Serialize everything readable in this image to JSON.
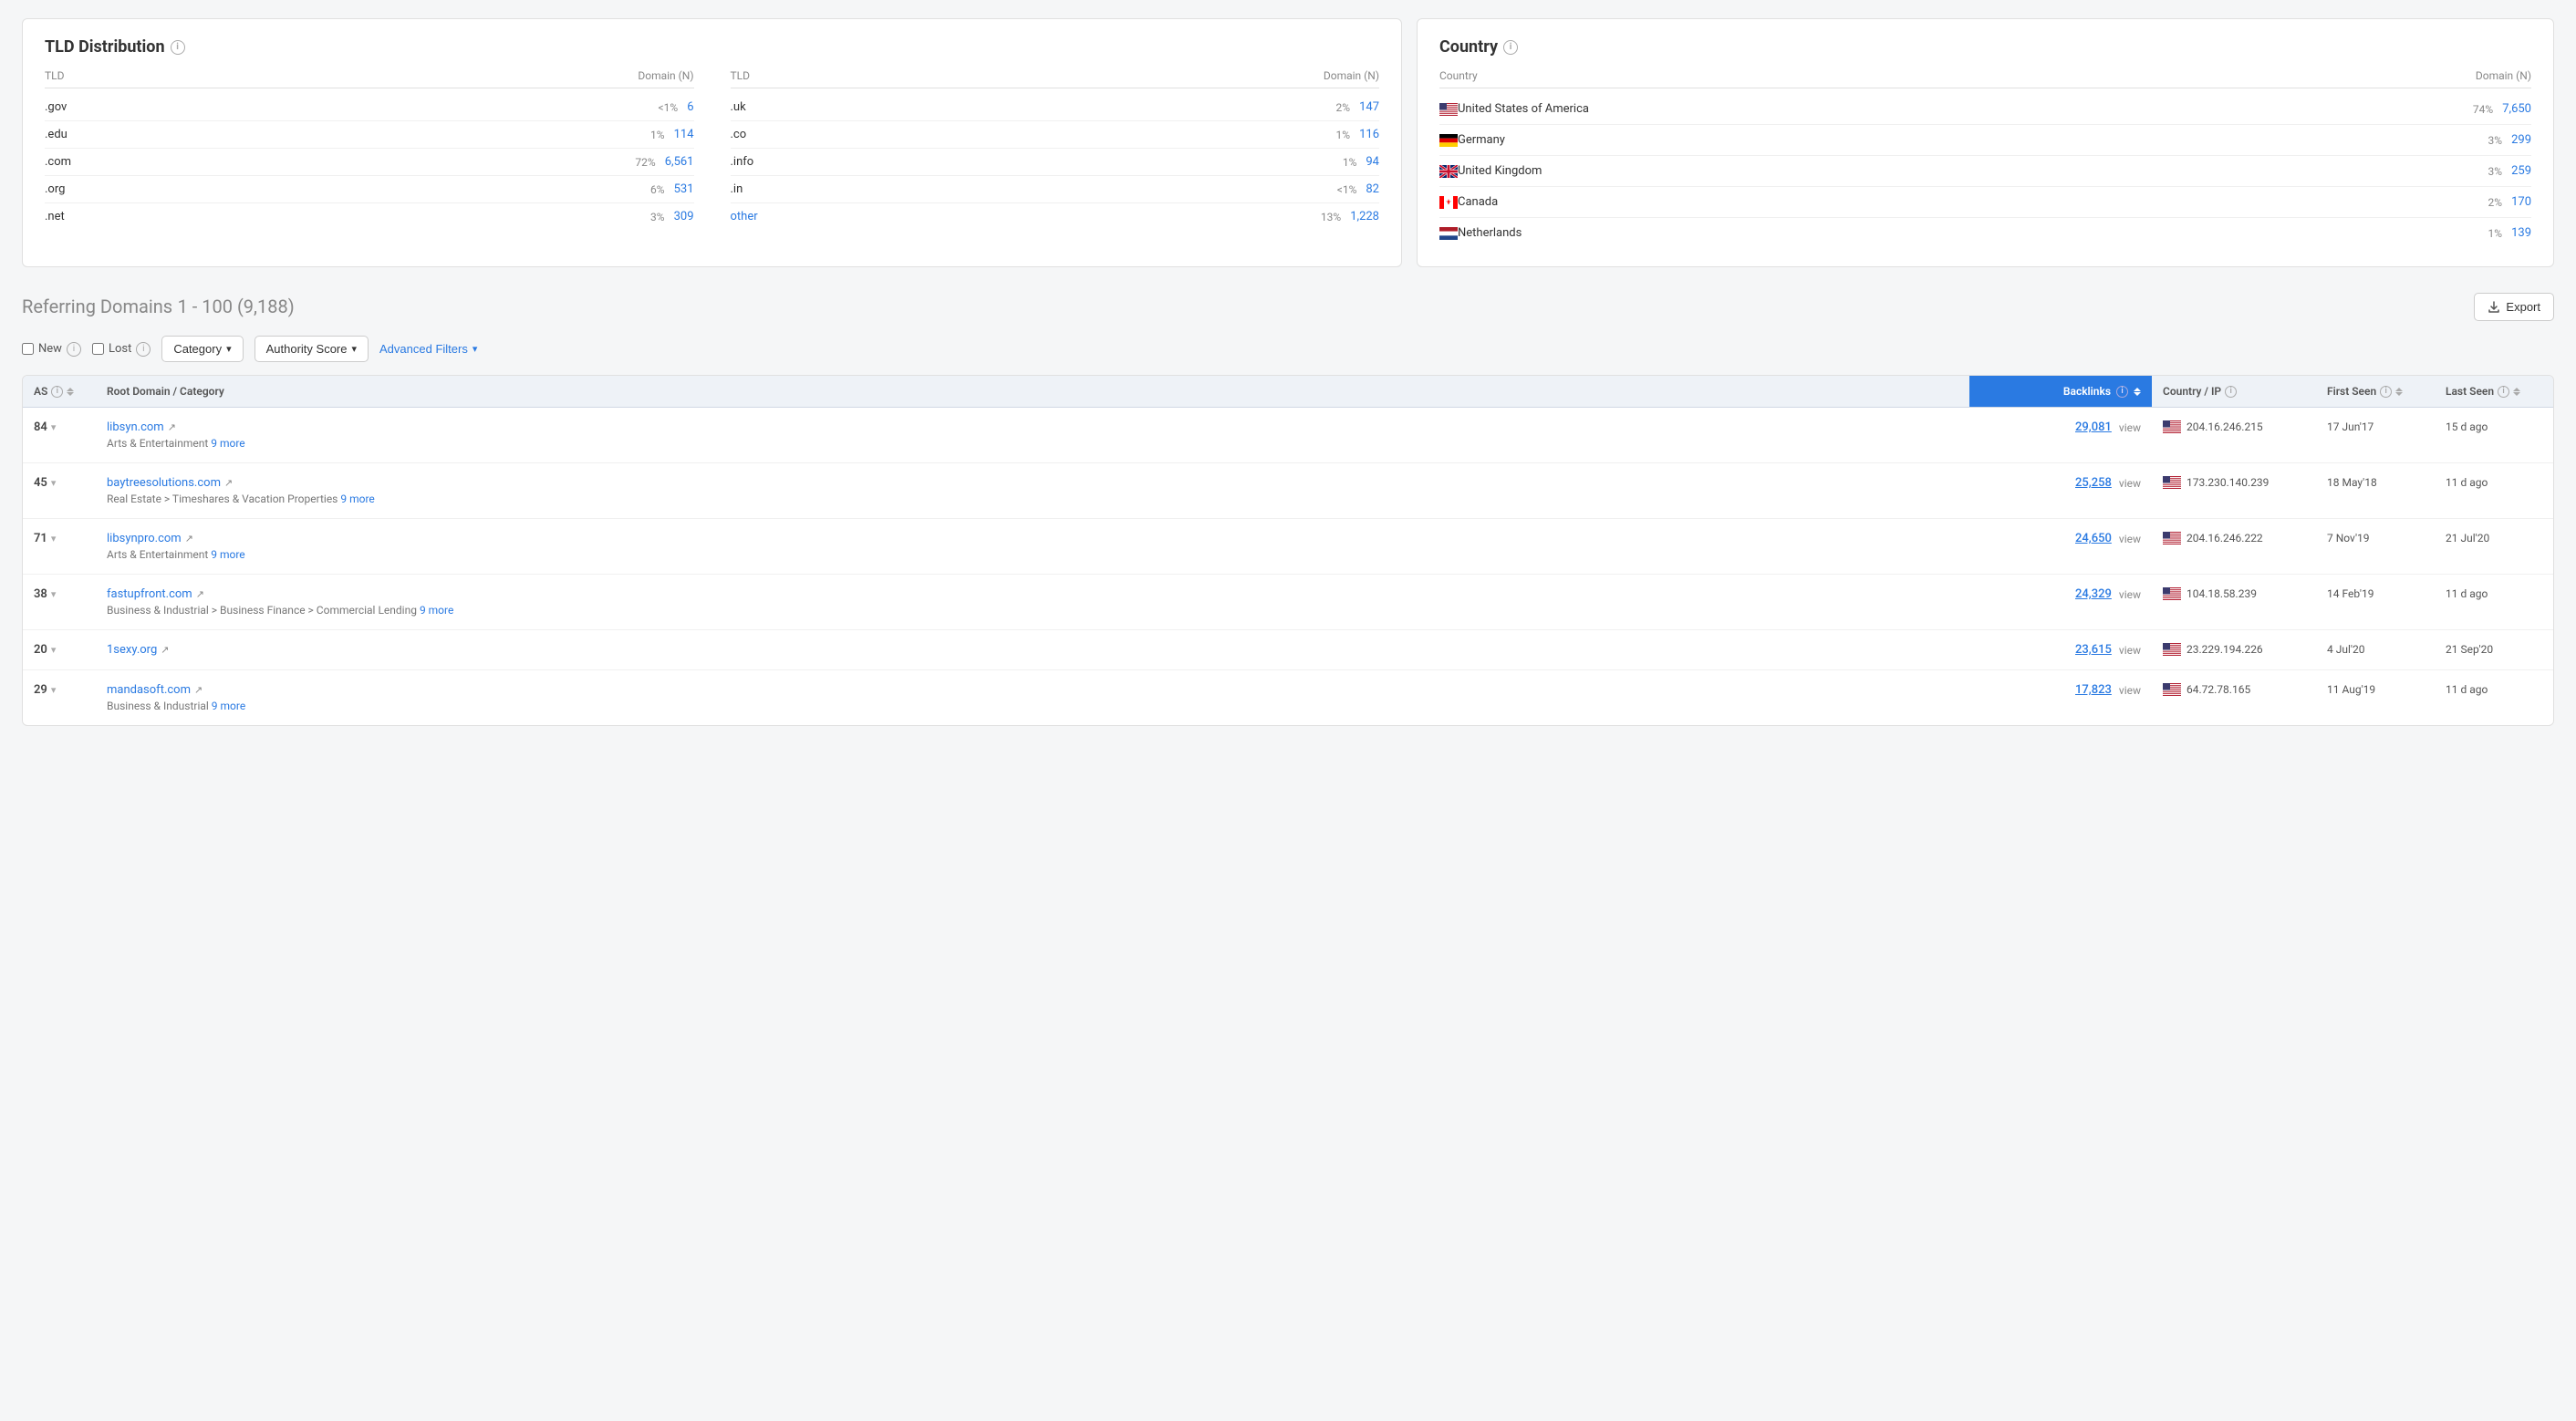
{
  "tld": {
    "title": "TLD Distribution",
    "col1_header": {
      "tld": "TLD",
      "domain": "Domain (N)"
    },
    "col2_header": {
      "tld": "TLD",
      "domain": "Domain (N)"
    },
    "col1": [
      {
        "name": ".gov",
        "pct": "<1%",
        "count": "6"
      },
      {
        "name": ".edu",
        "pct": "1%",
        "count": "114"
      },
      {
        "name": ".com",
        "pct": "72%",
        "count": "6,561"
      },
      {
        "name": ".org",
        "pct": "6%",
        "count": "531"
      },
      {
        "name": ".net",
        "pct": "3%",
        "count": "309"
      }
    ],
    "col2": [
      {
        "name": ".uk",
        "pct": "2%",
        "count": "147"
      },
      {
        "name": ".co",
        "pct": "1%",
        "count": "116"
      },
      {
        "name": ".info",
        "pct": "1%",
        "count": "94"
      },
      {
        "name": ".in",
        "pct": "<1%",
        "count": "82"
      },
      {
        "name": "other",
        "pct": "13%",
        "count": "1,228",
        "is_other": true
      }
    ]
  },
  "country": {
    "title": "Country",
    "header": {
      "country": "Country",
      "domain": "Domain (N)"
    },
    "rows": [
      {
        "name": "United States of America",
        "flag": "us",
        "pct": "74%",
        "count": "7,650"
      },
      {
        "name": "Germany",
        "flag": "de",
        "pct": "3%",
        "count": "299"
      },
      {
        "name": "United Kingdom",
        "flag": "gb",
        "pct": "3%",
        "count": "259"
      },
      {
        "name": "Canada",
        "flag": "ca",
        "pct": "2%",
        "count": "170"
      },
      {
        "name": "Netherlands",
        "flag": "nl",
        "pct": "1%",
        "count": "139"
      }
    ]
  },
  "referring": {
    "title": "Referring Domains",
    "range": "1 - 100 (9,188)",
    "export_label": "Export",
    "filters": {
      "new_label": "New",
      "lost_label": "Lost",
      "category_label": "Category",
      "authority_label": "Authority Score",
      "advanced_label": "Advanced Filters"
    },
    "table": {
      "headers": {
        "as": "AS",
        "domain": "Root Domain / Category",
        "backlinks": "Backlinks",
        "country": "Country / IP",
        "first_seen": "First Seen",
        "last_seen": "Last Seen"
      },
      "rows": [
        {
          "as": "84",
          "domain": "libsyn.com",
          "category": "Arts & Entertainment",
          "category_more": "9 more",
          "backlinks": "29,081",
          "country": "us",
          "ip": "204.16.246.215",
          "first_seen": "17 Jun'17",
          "last_seen": "15 d ago"
        },
        {
          "as": "45",
          "domain": "baytreesolutions.com",
          "category": "Real Estate > Timeshares & Vacation Properties",
          "category_more": "9 more",
          "backlinks": "25,258",
          "country": "us",
          "ip": "173.230.140.239",
          "first_seen": "18 May'18",
          "last_seen": "11 d ago"
        },
        {
          "as": "71",
          "domain": "libsynpro.com",
          "category": "Arts & Entertainment",
          "category_more": "9 more",
          "backlinks": "24,650",
          "country": "us",
          "ip": "204.16.246.222",
          "first_seen": "7 Nov'19",
          "last_seen": "21 Jul'20"
        },
        {
          "as": "38",
          "domain": "fastupfront.com",
          "category": "Business & Industrial > Business Finance > Commercial Lending",
          "category_more": "9 more",
          "backlinks": "24,329",
          "country": "us",
          "ip": "104.18.58.239",
          "first_seen": "14 Feb'19",
          "last_seen": "11 d ago"
        },
        {
          "as": "20",
          "domain": "1sexy.org",
          "category": "",
          "category_more": "",
          "backlinks": "23,615",
          "country": "us",
          "ip": "23.229.194.226",
          "first_seen": "4 Jul'20",
          "last_seen": "21 Sep'20"
        },
        {
          "as": "29",
          "domain": "mandasoft.com",
          "category": "Business & Industrial",
          "category_more": "9 more",
          "backlinks": "17,823",
          "country": "us",
          "ip": "64.72.78.165",
          "first_seen": "11 Aug'19",
          "last_seen": "11 d ago"
        }
      ]
    }
  },
  "colors": {
    "blue": "#2a7ae2",
    "light_blue_bg": "#eef2f7",
    "border": "#e0e0e0"
  }
}
